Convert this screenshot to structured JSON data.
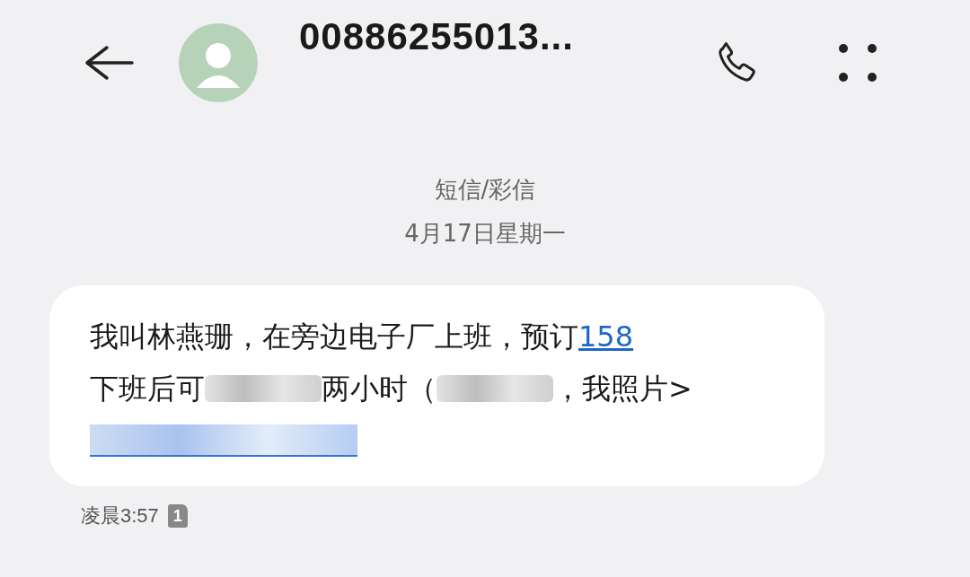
{
  "header": {
    "title": "00886255013..."
  },
  "thread": {
    "channel": "短信/彩信",
    "date": "4月17日星期一"
  },
  "message": {
    "lines": [
      [
        {
          "kind": "text",
          "text": "我叫林燕珊，在旁边电子厂上班，预订"
        },
        {
          "kind": "link",
          "text": "158"
        }
      ],
      [
        {
          "kind": "text",
          "text": "下班后可"
        },
        {
          "kind": "blur"
        },
        {
          "kind": "text",
          "text": "两小时（"
        },
        {
          "kind": "blur"
        },
        {
          "kind": "text",
          "text": "，我照片>"
        }
      ],
      [
        {
          "kind": "blur-link"
        }
      ]
    ],
    "time": "凌晨3:57",
    "sim": "1"
  }
}
